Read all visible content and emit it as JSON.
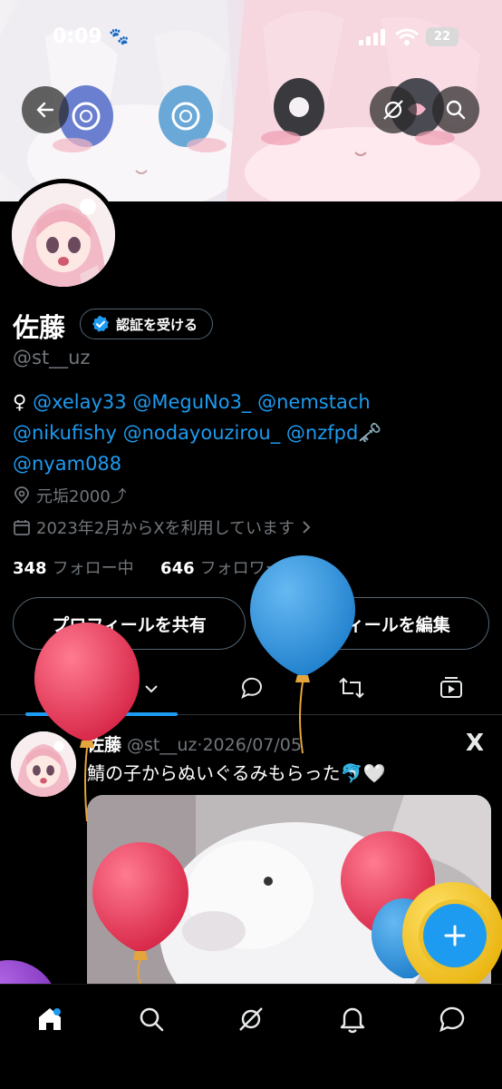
{
  "status_bar": {
    "time": "0:09",
    "battery": "22"
  },
  "profile": {
    "name": "佐藤",
    "verify_label": "認証を受ける",
    "handle": "@st__uz",
    "bio": {
      "prefix": "♀",
      "mentions_line1": [
        "@xelay33",
        "@MeguNo3_",
        "@nemstach"
      ],
      "mentions_line2": [
        "@nikufishy",
        "@nodayouzirou_",
        "@nzfpd"
      ],
      "line2_suffix": "🗝️",
      "mentions_line3": [
        "@nyam088"
      ]
    },
    "location": "元垢2000⤴︎",
    "joined": "2023年2月からXを利用しています",
    "following_count": "348",
    "following_label": "フォロー中",
    "followers_count": "646",
    "followers_label": "フォロワー"
  },
  "buttons": {
    "share_profile": "プロフィールを共有",
    "edit_profile": "プロフィールを編集"
  },
  "tabs": {
    "posts_label": "ポスト"
  },
  "post": {
    "name": "佐藤",
    "handle": "@st__uz",
    "separator": "·",
    "date": "2026/07/05",
    "text": "鯖の子からぬいぐるみもらった🐬🤍",
    "source_logo": "X"
  },
  "icons": [
    "back-arrow-icon",
    "grok-icon",
    "search-icon",
    "verified-badge-icon",
    "location-pin-icon",
    "calendar-icon",
    "chevron-right-icon",
    "posts-tab-icon",
    "chevron-down-icon",
    "reply-icon",
    "repost-icon",
    "media-icon",
    "plus-icon",
    "home-icon",
    "explore-search-icon",
    "grok-nav-icon",
    "bell-icon",
    "messages-icon"
  ],
  "colors": {
    "accent": "#1d9bf0",
    "background": "#000000",
    "muted": "#71767b",
    "balloon_red": "#e8344f",
    "balloon_blue": "#2a93de"
  }
}
